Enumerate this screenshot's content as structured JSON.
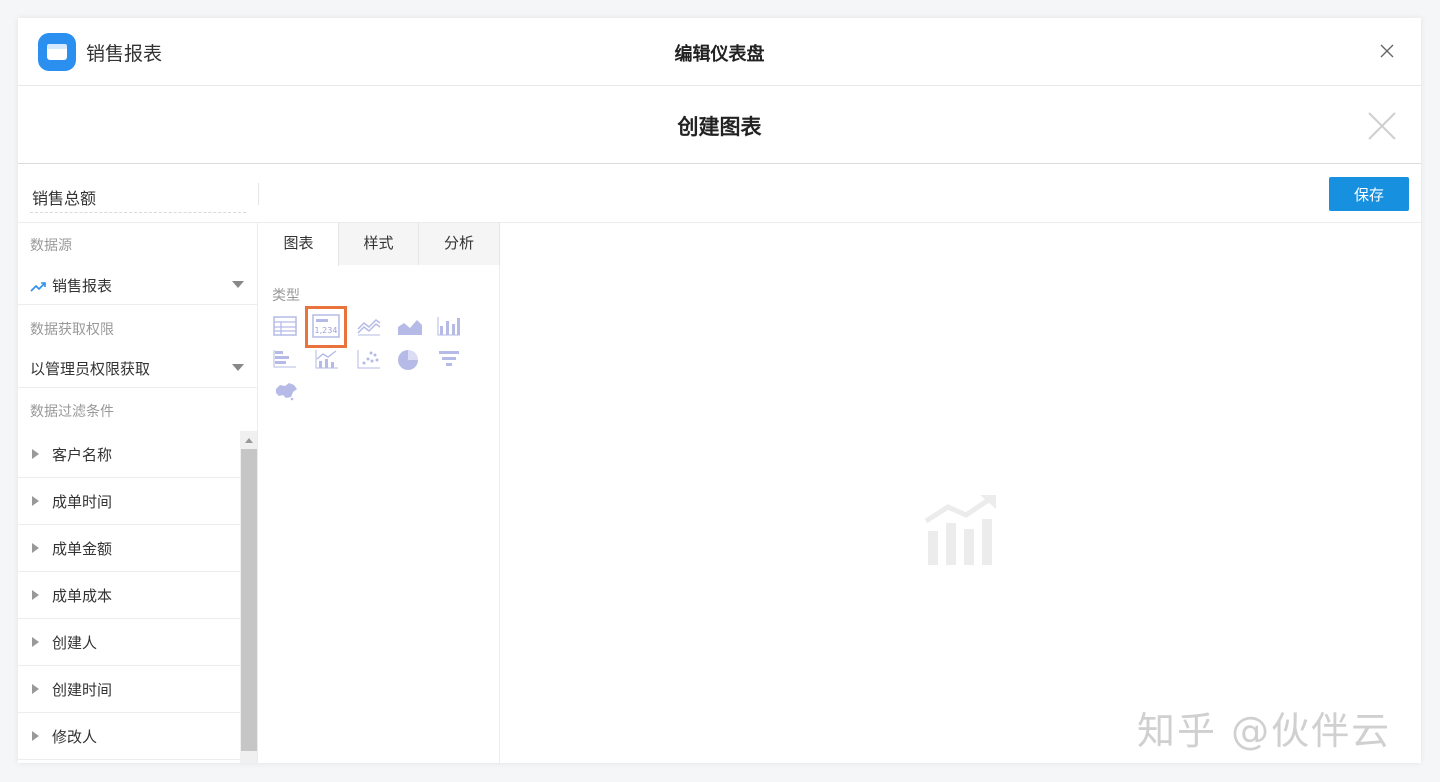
{
  "header": {
    "app_name": "销售报表",
    "title": "编辑仪表盘"
  },
  "modal": {
    "title": "创建图表"
  },
  "editor": {
    "chart_name": "销售总额",
    "save_label": "保存"
  },
  "data_source": {
    "label": "数据源",
    "selected": "销售报表",
    "permission_label": "数据获取权限",
    "permission_selected": "以管理员权限获取",
    "filter_label": "数据过滤条件",
    "filters": [
      "客户名称",
      "成单时间",
      "成单金额",
      "成单成本",
      "创建人",
      "创建时间",
      "修改人"
    ]
  },
  "tabs": [
    "图表",
    "样式",
    "分析"
  ],
  "type_section": {
    "label": "类型",
    "types": [
      "table-icon",
      "number-card-icon",
      "line-chart-icon",
      "area-chart-icon",
      "bar-chart-icon",
      "horizontal-bar-chart-icon",
      "combo-chart-icon",
      "scatter-chart-icon",
      "pie-chart-icon",
      "funnel-chart-icon",
      "map-chart-icon"
    ],
    "selected": "number-card-icon"
  },
  "colors": {
    "accent": "#1890e0",
    "selection": "#e8733d",
    "icon": "#b5bbe6"
  },
  "watermark": "知乎 @伙伴云"
}
